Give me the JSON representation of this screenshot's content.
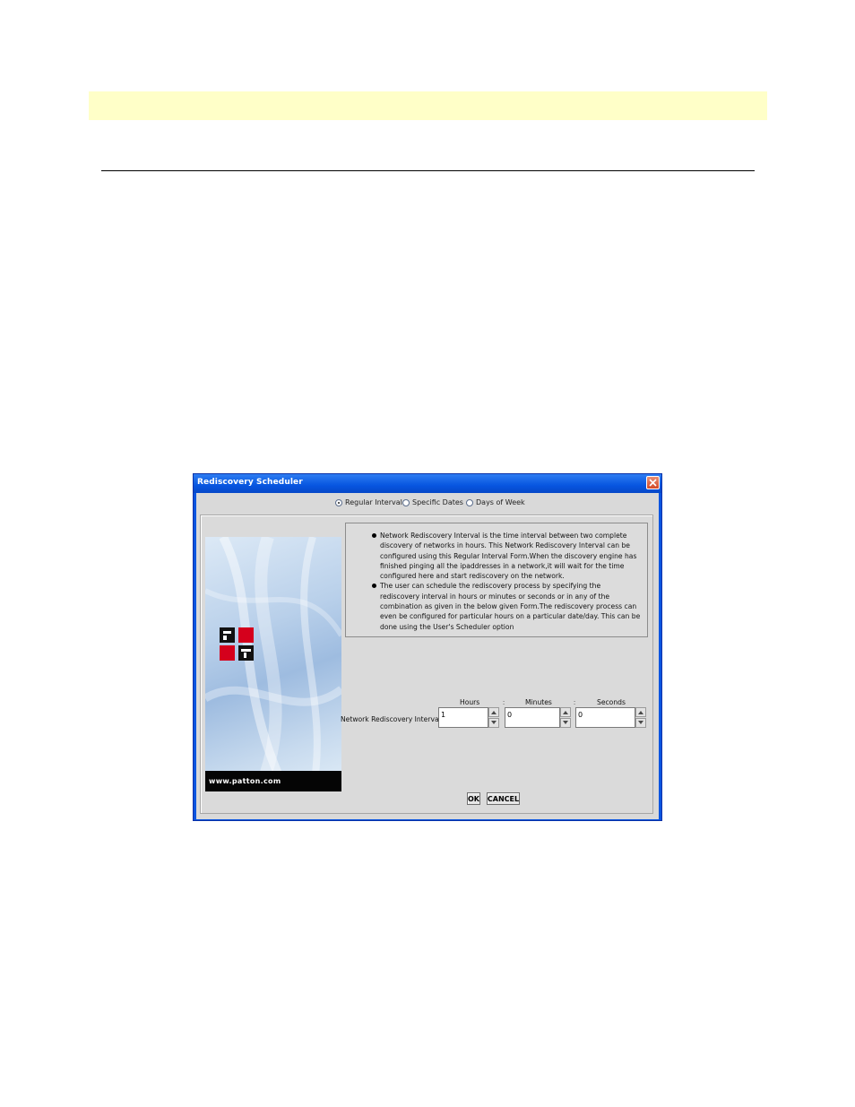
{
  "dialog": {
    "title": "Rediscovery Scheduler",
    "radios": [
      {
        "label": "Regular Interval",
        "checked": true
      },
      {
        "label": "Specific Dates",
        "checked": false
      },
      {
        "label": "Days of Week",
        "checked": false
      }
    ],
    "brand_url": "www.patton.com",
    "bullets": [
      "Network Rediscovery Interval is the time interval between two complete discovery of networks in hours. This Network Rediscovery Interval can be configured using this Regular Interval Form.When the discovery engine has finished pinging all the ipaddresses in a network,it will wait for the time configured here and start rediscovery on the network.",
      "The user can schedule the rediscovery process by specifying the rediscovery interval in hours or minutes or seconds or in any of the combination as given in the below given Form.The rediscovery process can even be configured for particular hours on a particular date/day. This can be done using the User's Scheduler option"
    ],
    "interval_label": "Network Rediscovery Interval",
    "columns": {
      "hours": "Hours",
      "minutes": "Minutes",
      "seconds": "Seconds"
    },
    "colon": ":",
    "values": {
      "hours": "1",
      "minutes": "0",
      "seconds": "0"
    },
    "ok_label": "OK",
    "cancel_label": "CANCEL"
  },
  "colors": {
    "titlebar": "#0756e0",
    "client_bg": "#d9d9d9",
    "band": "#ffffc8"
  },
  "icons": [
    "close-icon",
    "spin-up-icon",
    "spin-down-icon",
    "patton-logo"
  ]
}
